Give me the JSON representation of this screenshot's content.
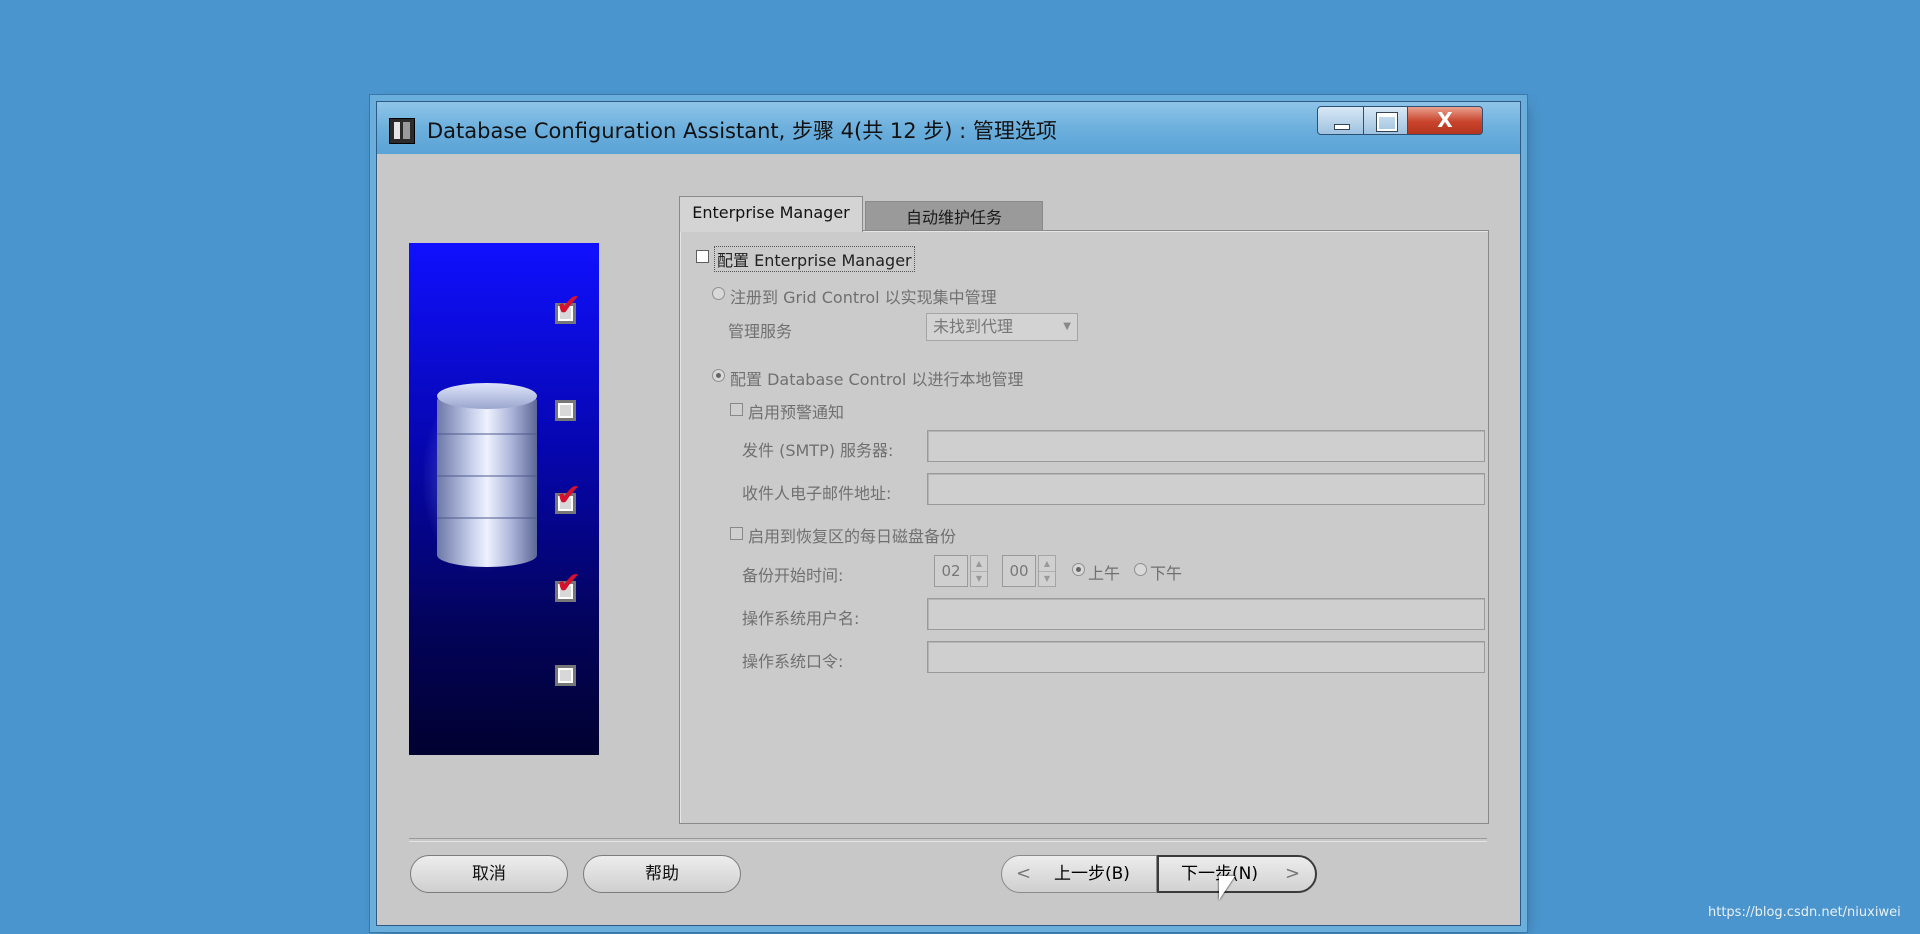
{
  "window": {
    "title": "Database Configuration Assistant, 步骤 4(共 12 步) : 管理选项",
    "controls": {
      "close_glyph": "X"
    }
  },
  "steps": [
    {
      "checked": true
    },
    {
      "checked": false
    },
    {
      "checked": true
    },
    {
      "checked": true
    },
    {
      "checked": false
    }
  ],
  "tabs": [
    {
      "label": "Enterprise Manager",
      "active": true
    },
    {
      "label": "自动维护任务",
      "active": false
    }
  ],
  "em": {
    "configure_label": "配置 Enterprise Manager",
    "configure_checked": false,
    "grid_control_label": "注册到 Grid Control 以实现集中管理",
    "mgmt_service_label": "管理服务",
    "mgmt_service_value": "未找到代理",
    "db_control_label": "配置 Database Control 以进行本地管理",
    "alerts_label": "启用预警通知",
    "smtp_label": "发件 (SMTP) 服务器:",
    "smtp_value": "",
    "email_label": "收件人电子邮件地址:",
    "email_value": "",
    "backup_label": "启用到恢复区的每日磁盘备份",
    "backup_time_label": "备份开始时间:",
    "backup_hour": "02",
    "backup_minute": "00",
    "am_label": "上午",
    "pm_label": "下午",
    "os_user_label": "操作系统用户名:",
    "os_user_value": "",
    "os_password_label": "操作系统口令:",
    "os_password_value": ""
  },
  "buttons": {
    "cancel": "取消",
    "help": "帮助",
    "prev": "上一步(B)",
    "next": "下一步(N)",
    "prev_chevron": "<",
    "next_chevron": ">"
  },
  "watermark": "https://blog.csdn.net/niuxiwei",
  "colors": {
    "desktop": "#4a95cd",
    "window_bg": "#c8c8c8",
    "check_red": "#d5112d"
  }
}
